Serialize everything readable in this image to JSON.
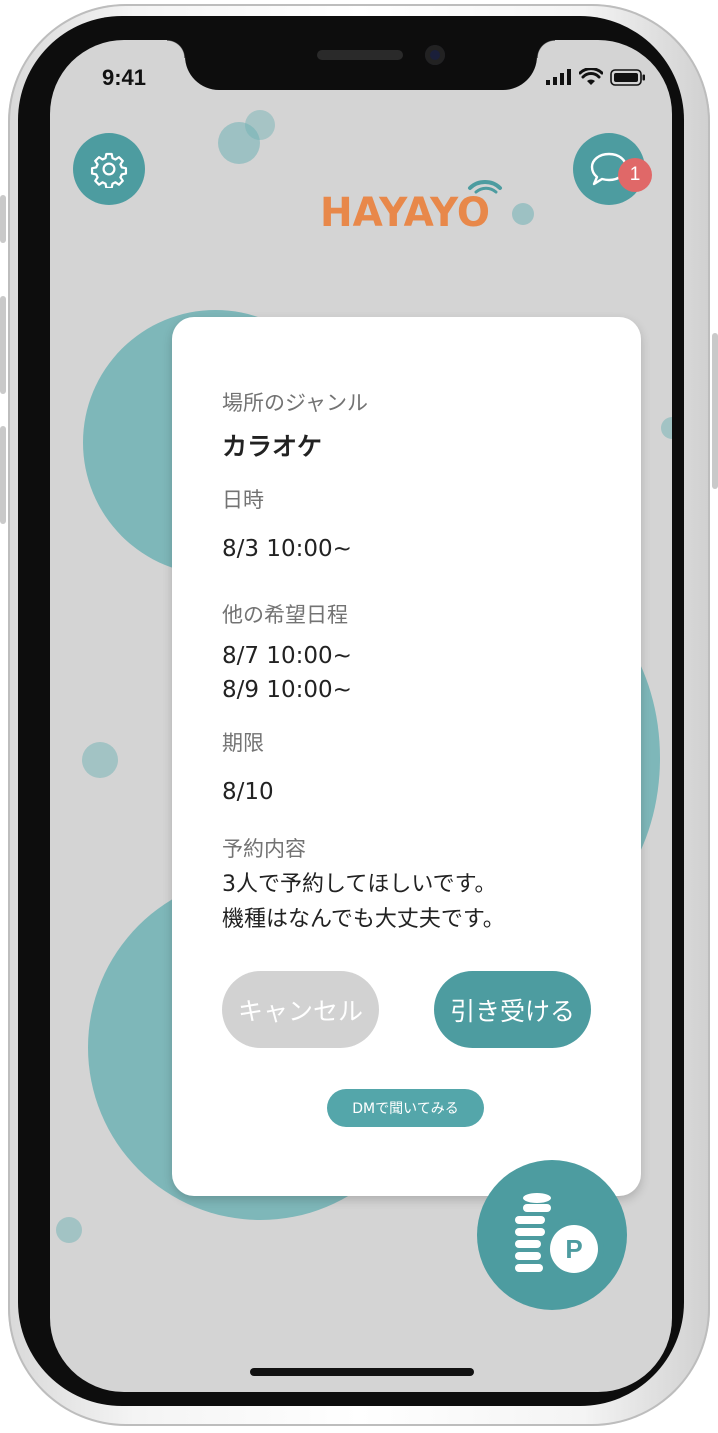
{
  "status_bar": {
    "time": "9:41"
  },
  "header": {
    "logo_text": "HAYAYO",
    "notification_count": "1",
    "icons": {
      "settings": "gear-icon",
      "messages": "chat-bubble-icon"
    }
  },
  "card": {
    "genre_label": "場所のジャンル",
    "genre_value": "カラオケ",
    "datetime_label": "日時",
    "datetime_value": "8/3 10:00~",
    "alt_dates_label": "他の希望日程",
    "alt_dates": [
      "8/7 10:00~",
      "8/9 10:00~"
    ],
    "deadline_label": "期限",
    "deadline_value": "8/10",
    "details_label": "予約内容",
    "details_lines": [
      "3人で予約してほしいです。",
      "機種はなんでも大丈夫です。"
    ],
    "cancel_label": "キャンセル",
    "accept_label": "引き受ける",
    "dm_label": "DMで聞いてみる"
  },
  "points_button": {
    "icon": "coins-icon",
    "badge_letter": "P"
  },
  "colors": {
    "accent": "#4d9ca0",
    "accent_light": "#54a6aa",
    "cancel_gray": "#d2d2d2",
    "badge_red": "#e06868",
    "logo_orange": "#e8884a",
    "background": "#d4d4d4"
  }
}
